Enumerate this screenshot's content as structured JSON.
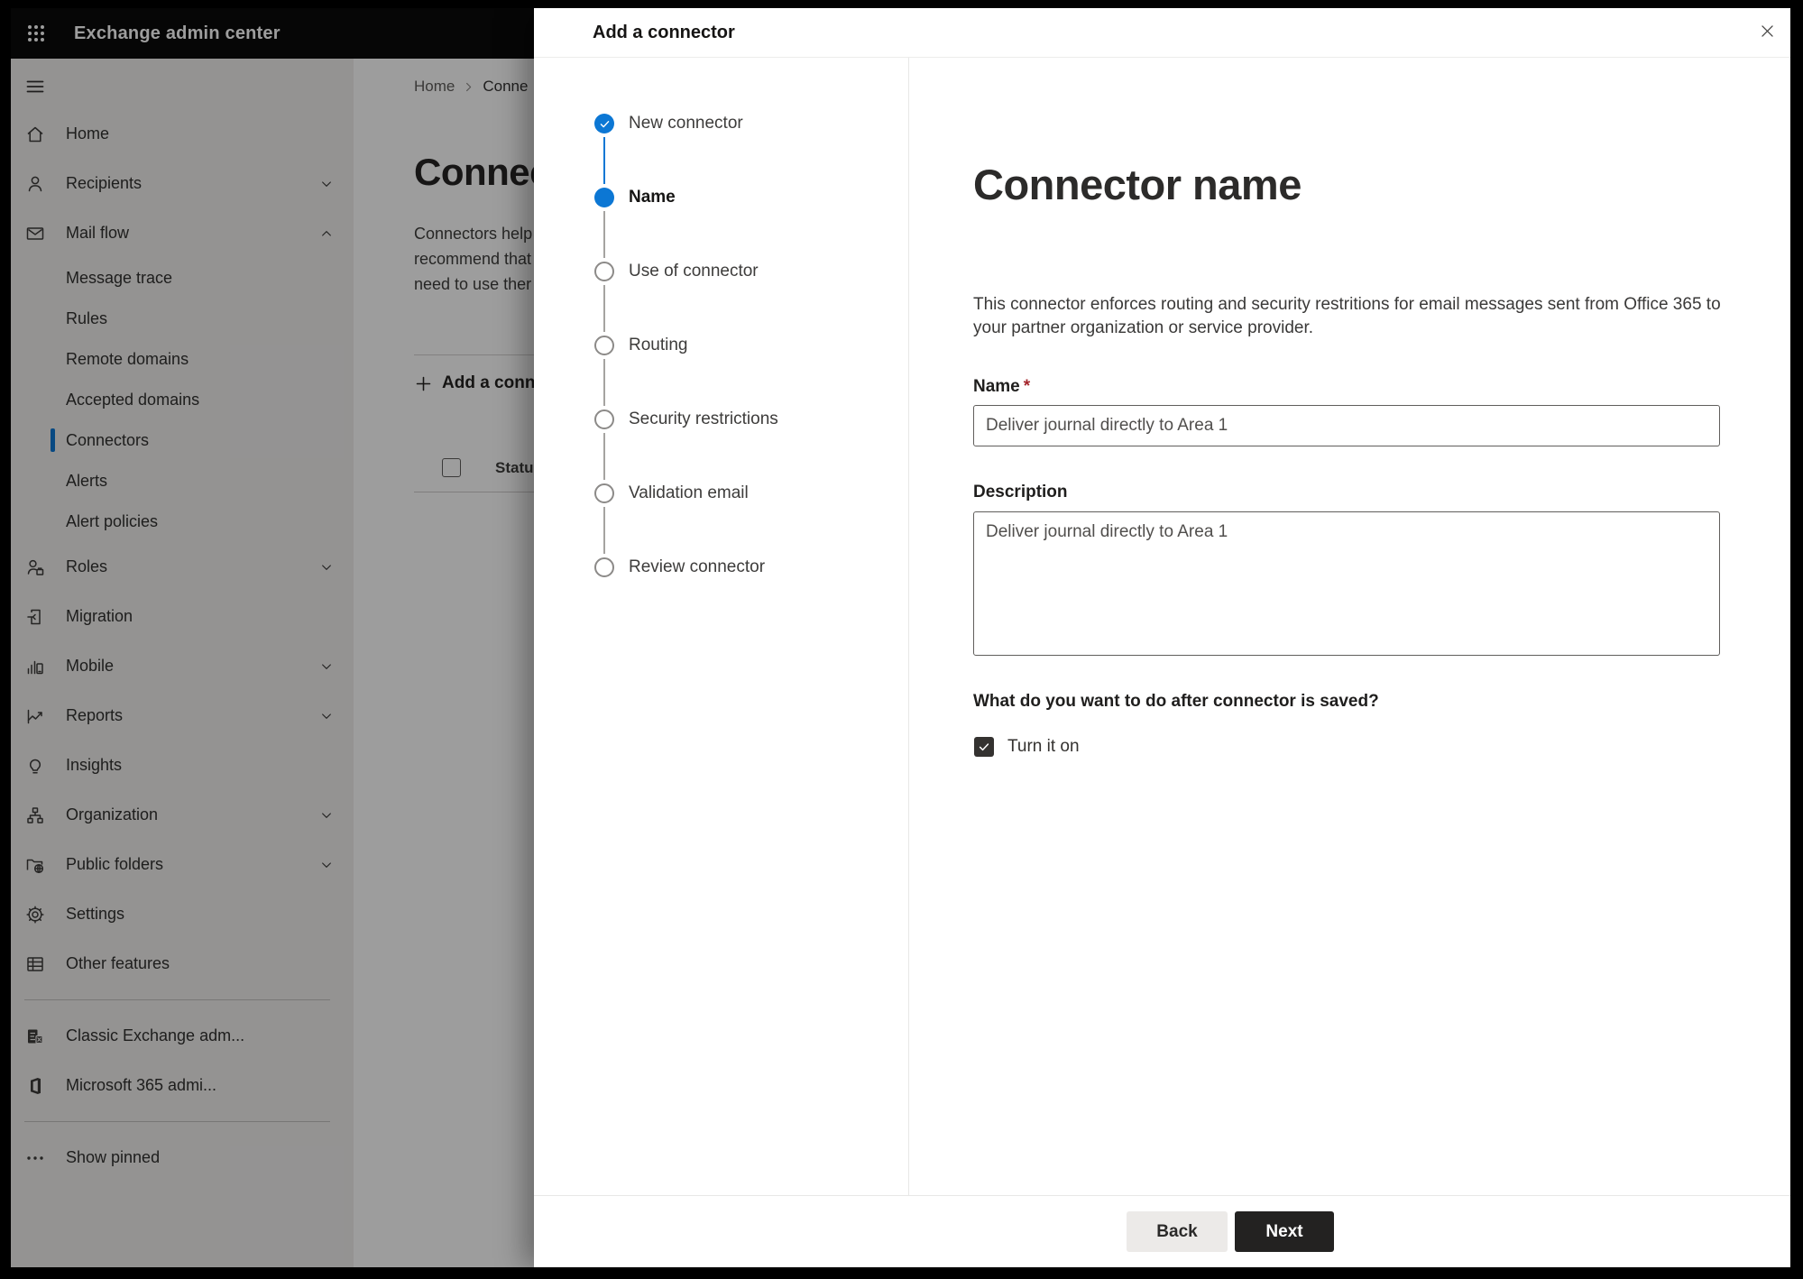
{
  "topbar": {
    "title": "Exchange admin center"
  },
  "sidebar": {
    "items": [
      {
        "label": "Home",
        "icon": "home-icon"
      },
      {
        "label": "Recipients",
        "icon": "person-icon",
        "chevron": "down"
      },
      {
        "label": "Mail flow",
        "icon": "mail-icon",
        "chevron": "up"
      },
      {
        "label": "Message trace",
        "sub": true
      },
      {
        "label": "Rules",
        "sub": true
      },
      {
        "label": "Remote domains",
        "sub": true
      },
      {
        "label": "Accepted domains",
        "sub": true
      },
      {
        "label": "Connectors",
        "sub": true,
        "selected": true
      },
      {
        "label": "Alerts",
        "sub": true
      },
      {
        "label": "Alert policies",
        "sub": true
      },
      {
        "label": "Roles",
        "icon": "roles-icon",
        "chevron": "down"
      },
      {
        "label": "Migration",
        "icon": "migration-icon"
      },
      {
        "label": "Mobile",
        "icon": "mobile-icon",
        "chevron": "down"
      },
      {
        "label": "Reports",
        "icon": "reports-icon",
        "chevron": "down"
      },
      {
        "label": "Insights",
        "icon": "insights-icon"
      },
      {
        "label": "Organization",
        "icon": "organization-icon",
        "chevron": "down"
      },
      {
        "label": "Public folders",
        "icon": "public-folders-icon",
        "chevron": "down"
      },
      {
        "label": "Settings",
        "icon": "settings-icon"
      },
      {
        "label": "Other features",
        "icon": "other-features-icon"
      },
      {
        "type": "divider"
      },
      {
        "label": "Classic Exchange adm...",
        "icon": "classic-exchange-icon"
      },
      {
        "label": "Microsoft 365 admi...",
        "icon": "microsoft-365-icon"
      },
      {
        "type": "divider"
      },
      {
        "label": "Show pinned",
        "icon": "ellipsis-icon"
      }
    ]
  },
  "page": {
    "breadcrumb": {
      "home": "Home",
      "current": "Conne",
      "separator_icon": "chevron-right-icon"
    },
    "heading": "Connec",
    "intro_lines": [
      "Connectors help",
      "recommend that",
      "need to use ther"
    ],
    "add_connector_button": "Add a conn",
    "table": {
      "status_header": "Status"
    }
  },
  "panel": {
    "title": "Add a connector",
    "close_icon": "close-icon",
    "steps": [
      {
        "label": "New connector",
        "state": "completed"
      },
      {
        "label": "Name",
        "state": "current"
      },
      {
        "label": "Use of connector",
        "state": "upcoming"
      },
      {
        "label": "Routing",
        "state": "upcoming"
      },
      {
        "label": "Security restrictions",
        "state": "upcoming"
      },
      {
        "label": "Validation email",
        "state": "upcoming"
      },
      {
        "label": "Review connector",
        "state": "upcoming"
      }
    ],
    "content": {
      "title": "Connector name",
      "description": "This connector enforces routing and security restritions for email messages sent from Office 365 to your partner organization or service provider.",
      "name_field": {
        "label": "Name",
        "required_marker": "*",
        "value": "Deliver journal directly to Area 1"
      },
      "description_field": {
        "label": "Description",
        "value": "Deliver journal directly to Area 1"
      },
      "after_save": {
        "question": "What do you want to do after connector is saved?",
        "checkbox_label": "Turn it on",
        "checked": true
      }
    },
    "footer": {
      "back": "Back",
      "next": "Next"
    }
  },
  "colors": {
    "accent_blue": "#0c77d4",
    "primary_button": "#232221",
    "required_red": "#a4262c",
    "overlay": "rgba(0,0,0,0.385)"
  }
}
